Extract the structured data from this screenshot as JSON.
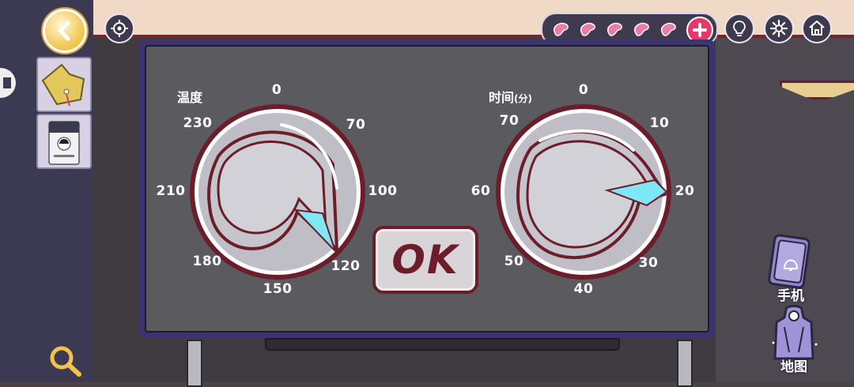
{
  "hud": {
    "beans_count": 5,
    "icons": [
      "back-icon",
      "target-icon",
      "bean-icon",
      "plus-icon",
      "lightbulb-icon",
      "gear-icon",
      "home-icon",
      "search-icon"
    ]
  },
  "inventory": [
    {
      "name": "yellow-tag"
    },
    {
      "name": "id-badge"
    }
  ],
  "temperature_dial": {
    "label": "温度",
    "ticks": [
      "0",
      "70",
      "100",
      "120",
      "150",
      "180",
      "210",
      "230"
    ]
  },
  "time_dial": {
    "label_main": "时间",
    "label_unit": "(分)",
    "ticks": [
      "0",
      "10",
      "20",
      "30",
      "40",
      "50",
      "60",
      "70"
    ]
  },
  "ok_button": {
    "label": "OK"
  },
  "side_menu": {
    "phone_label": "手机",
    "map_label": "地图"
  },
  "colors": {
    "panel_border": "#3b3470",
    "panel_face": "#5b5a5f",
    "dial_rim": "#6b1e2a",
    "pointer": "#7ee8f7",
    "bean": "#f07aa6"
  }
}
